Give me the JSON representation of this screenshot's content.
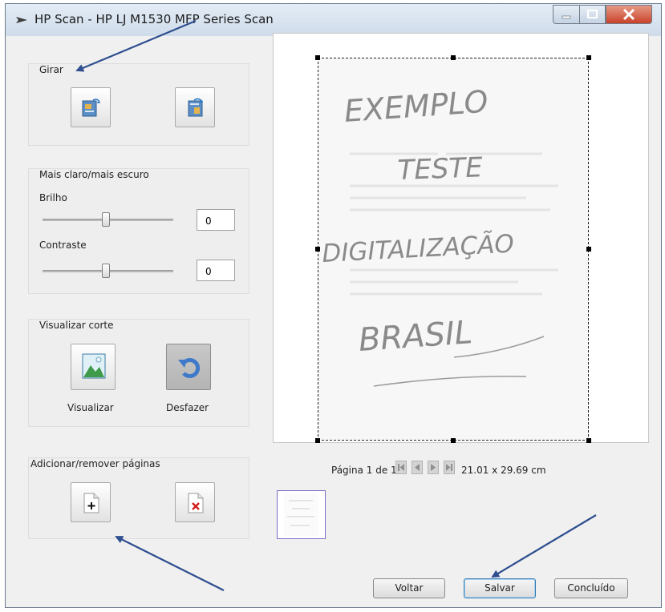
{
  "window": {
    "title": "HP Scan - HP LJ M1530 MFP Series Scan"
  },
  "rotate": {
    "label": "Girar"
  },
  "adjust": {
    "label": "Mais claro/mais escuro",
    "brightness_label": "Brilho",
    "brightness_value": "0",
    "contrast_label": "Contraste",
    "contrast_value": "0"
  },
  "crop": {
    "label": "Visualizar corte",
    "view_label": "Visualizar",
    "undo_label": "Desfazer"
  },
  "pages": {
    "label": "Adicionar/remover páginas"
  },
  "preview": {
    "page_text": "Página 1 de 1",
    "size_text": "21.01 x 29.69 cm",
    "handwriting": [
      "EXEMPLO",
      "TESTE",
      "DIGITALIZAÇÃO",
      "BRASIL"
    ]
  },
  "buttons": {
    "back": "Voltar",
    "save": "Salvar",
    "done": "Concluído"
  },
  "colors": {
    "annotation_arrow": "#2f4f8f",
    "close_button": "#c9412a",
    "thumbnail_border": "#7b6fc7"
  }
}
